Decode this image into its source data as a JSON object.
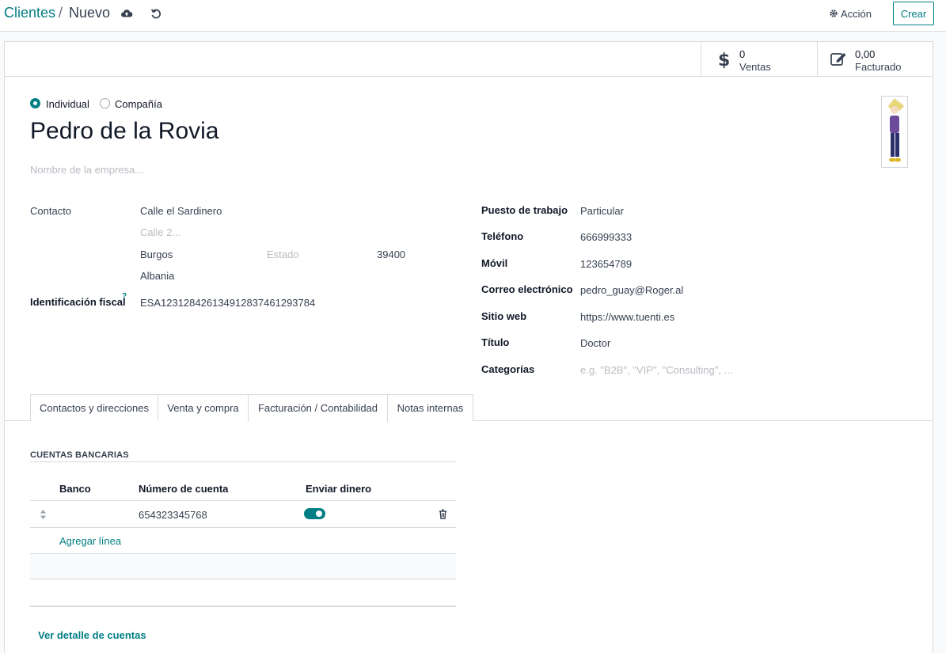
{
  "breadcrumb": {
    "parent": "Clientes",
    "sep": "/",
    "current": "Nuevo"
  },
  "header": {
    "action_label": "Acción",
    "create_label": "Crear"
  },
  "stats": [
    {
      "value": "0",
      "label": "Ventas",
      "icon": "dollar-icon"
    },
    {
      "value": "0,00",
      "label": "Facturado",
      "icon": "edit-icon"
    }
  ],
  "type_options": {
    "individual": "Individual",
    "company": "Compañía",
    "selected": "Individual"
  },
  "partner": {
    "name": "Pedro de la Rovia",
    "company_placeholder": "Nombre de la empresa..."
  },
  "left": {
    "contact_label": "Contacto",
    "street": "Calle el Sardinero",
    "street2_placeholder": "Calle 2...",
    "city": "Burgos",
    "state_placeholder": "Estado",
    "zip": "39400",
    "country": "Albania",
    "vat_label": "Identificación fiscal",
    "vat_help": "?",
    "vat": "ESA12312842613491283746129378​4"
  },
  "right": {
    "job_label": "Puesto de trabajo",
    "job": "Particular",
    "phone_label": "Teléfono",
    "phone": "666999333",
    "mobile_label": "Móvil",
    "mobile": "123654789",
    "email_label": "Correo electrónico",
    "email": "pedro_guay@Roger.al",
    "website_label": "Sitio web",
    "website": "https://www.tuenti.es",
    "title_label": "Título",
    "title": "Doctor",
    "tags_label": "Categorías",
    "tags_placeholder": "e.g. \"B2B\", \"VIP\", \"Consulting\", ..."
  },
  "tabs": [
    {
      "label": "Contactos y direcciones"
    },
    {
      "label": "Venta y compra"
    },
    {
      "label": "Facturación / Contabilidad"
    },
    {
      "label": "Notas internas"
    }
  ],
  "bank": {
    "section_title": "CUENTAS BANCARIAS",
    "col_bank": "Banco",
    "col_account": "Número de cuenta",
    "col_send": "Enviar dinero",
    "rows": [
      {
        "bank": "",
        "account": "654323345768",
        "send_money": true
      }
    ],
    "add_line": "Agregar línea",
    "view_details": "Ver detalle de cuentas"
  },
  "colors": {
    "accent": "#017e84",
    "toggle": "#017e84"
  }
}
